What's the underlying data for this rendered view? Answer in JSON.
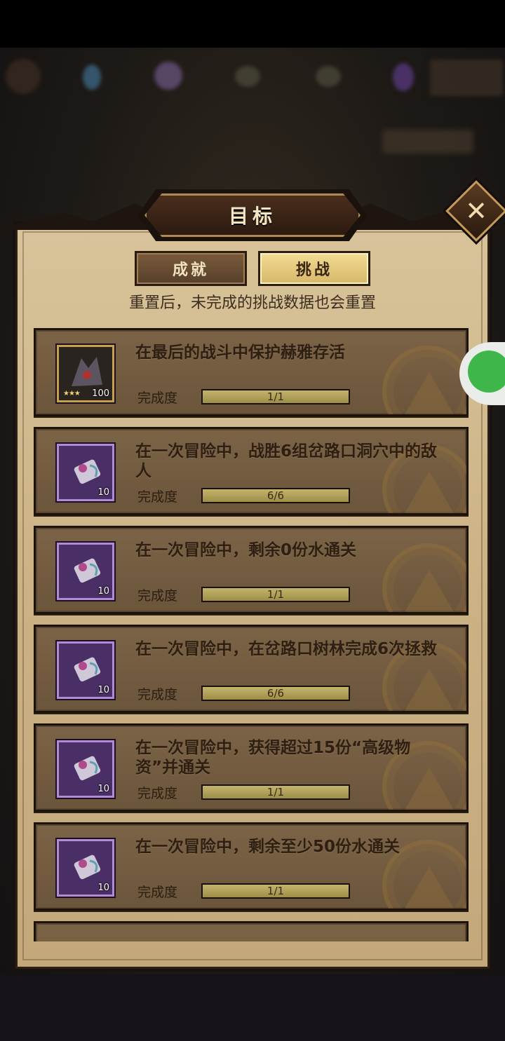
{
  "popup": {
    "title": "目标",
    "close_symbol": "✕",
    "tabs": [
      {
        "label": "成就",
        "selected": false
      },
      {
        "label": "挑战",
        "selected": true
      }
    ],
    "hint": "重置后，未完成的挑战数据也会重置",
    "progress_label": "完成度"
  },
  "challenges": [
    {
      "title": "在最后的战斗中保护赫雅存活",
      "icon": "hero-portrait-icon",
      "reward_count": "100",
      "stars": "★★★",
      "progress": "1/1",
      "progress_fraction": 1
    },
    {
      "title": "在一次冒险中，战胜6组岔路口洞穴中的敌人",
      "icon": "purple-scroll-icon",
      "reward_count": "10",
      "progress": "6/6",
      "progress_fraction": 1
    },
    {
      "title": "在一次冒险中，剩余0份水通关",
      "icon": "purple-scroll-icon",
      "reward_count": "10",
      "progress": "1/1",
      "progress_fraction": 1
    },
    {
      "title": "在一次冒险中，在岔路口树林完成6次拯救",
      "icon": "purple-scroll-icon",
      "reward_count": "10",
      "progress": "6/6",
      "progress_fraction": 1
    },
    {
      "title": "在一次冒险中，获得超过15份“高级物资”并通关",
      "icon": "purple-scroll-icon",
      "reward_count": "10",
      "progress": "1/1",
      "progress_fraction": 1
    },
    {
      "title": "在一次冒险中，剩余至少50份水通关",
      "icon": "purple-scroll-icon",
      "reward_count": "10",
      "progress": "1/1",
      "progress_fraction": 1
    }
  ],
  "colors": {
    "panel": "#cbb285",
    "card": "#6b553b",
    "tab_selected": "#e6c97c",
    "wechat": "#3fb64a"
  }
}
